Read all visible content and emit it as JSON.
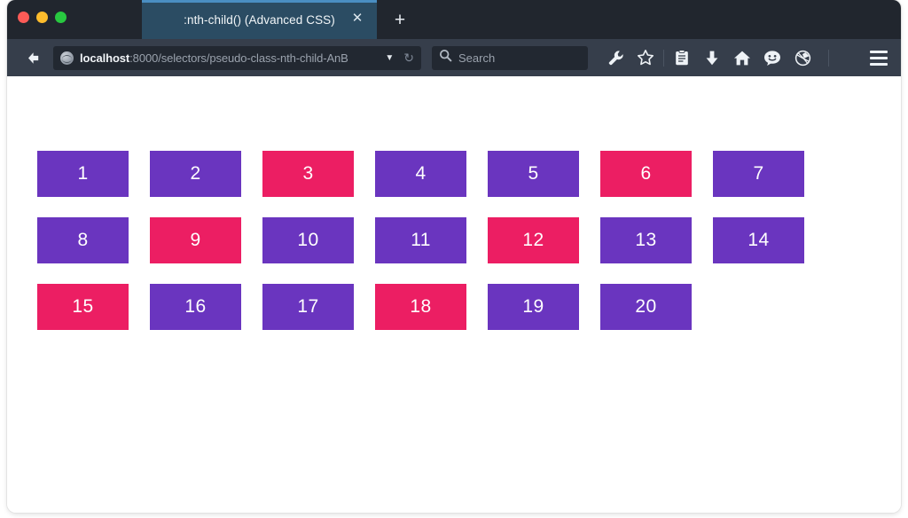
{
  "window": {
    "traffic_lights": [
      {
        "name": "close",
        "color": "#fc5b57"
      },
      {
        "name": "minimize",
        "color": "#fdbc2c"
      },
      {
        "name": "zoom",
        "color": "#28c840"
      }
    ]
  },
  "tabs": {
    "active": {
      "title": ":nth-child() (Advanced CSS)",
      "close_label": "✕"
    },
    "new_tab_label": "+"
  },
  "toolbar": {
    "back_label": "Back",
    "url": {
      "host": "localhost",
      "path": ":8000/selectors/pseudo-class-nth-child-AnB",
      "full": "localhost:8000/selectors/pseudo-class-nth-child-AnB",
      "dropdown_label": "▼",
      "reload_label": "↻"
    },
    "search": {
      "placeholder": "Search",
      "value": ""
    },
    "icons": [
      {
        "name": "wrench-icon",
        "label": "Developer Tools"
      },
      {
        "name": "star-icon",
        "label": "Bookmark"
      },
      {
        "name": "reader-icon",
        "label": "Reading List"
      },
      {
        "name": "download-icon",
        "label": "Downloads"
      },
      {
        "name": "home-icon",
        "label": "Home"
      },
      {
        "name": "smiley-icon",
        "label": "Feedback"
      },
      {
        "name": "pocket-icon",
        "label": "Save to Pocket"
      }
    ],
    "menu_label": "Open Menu"
  },
  "content": {
    "colors": {
      "normal": "#6a35bf",
      "highlight": "#ec1e63"
    },
    "highlight_pattern": "3n",
    "cells": [
      {
        "label": "1",
        "highlighted": false
      },
      {
        "label": "2",
        "highlighted": false
      },
      {
        "label": "3",
        "highlighted": true
      },
      {
        "label": "4",
        "highlighted": false
      },
      {
        "label": "5",
        "highlighted": false
      },
      {
        "label": "6",
        "highlighted": true
      },
      {
        "label": "7",
        "highlighted": false
      },
      {
        "label": "8",
        "highlighted": false
      },
      {
        "label": "9",
        "highlighted": true
      },
      {
        "label": "10",
        "highlighted": false
      },
      {
        "label": "11",
        "highlighted": false
      },
      {
        "label": "12",
        "highlighted": true
      },
      {
        "label": "13",
        "highlighted": false
      },
      {
        "label": "14",
        "highlighted": false
      },
      {
        "label": "15",
        "highlighted": true
      },
      {
        "label": "16",
        "highlighted": false
      },
      {
        "label": "17",
        "highlighted": false
      },
      {
        "label": "18",
        "highlighted": true
      },
      {
        "label": "19",
        "highlighted": false
      },
      {
        "label": "20",
        "highlighted": false
      }
    ]
  }
}
